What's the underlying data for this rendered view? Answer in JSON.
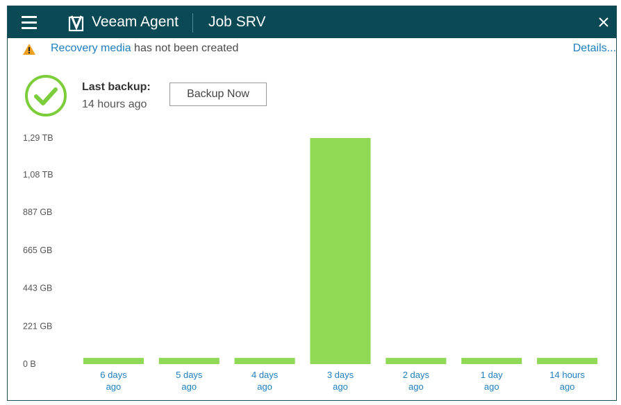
{
  "header": {
    "app_title": "Veeam Agent",
    "job_title": "Job SRV",
    "icons": {
      "menu": "hamburger-menu-icon",
      "logo": "veeam-logo-icon",
      "close": "close-icon"
    }
  },
  "warning": {
    "icon": "warning-triangle-icon",
    "link_text": "Recovery media",
    "text": " has not been created",
    "details_link": "Details..."
  },
  "status": {
    "icon": "success-check-icon",
    "last_backup_label": "Last backup:",
    "last_backup_time": "14 hours ago",
    "backup_now_label": "Backup Now"
  },
  "colors": {
    "titlebar": "#0b4a55",
    "accent_green": "#8fd957",
    "check_green": "#7ccd3c",
    "link_blue": "#1e7fc0",
    "warning_orange": "#f0a020"
  },
  "chart_data": {
    "type": "bar",
    "categories": [
      [
        "6 days",
        "ago"
      ],
      [
        "5 days",
        "ago"
      ],
      [
        "4 days",
        "ago"
      ],
      [
        "3 days",
        "ago"
      ],
      [
        "2 days",
        "ago"
      ],
      [
        "1 day",
        "ago"
      ],
      [
        "14 hours",
        "ago"
      ]
    ],
    "values_gb": [
      36,
      36,
      36,
      1321,
      36,
      36,
      36
    ],
    "yticks": [
      "0 B",
      "221 GB",
      "443 GB",
      "665 GB",
      "887 GB",
      "1,08 TB",
      "1,29 TB"
    ],
    "ytick_values_gb": [
      0,
      221,
      443,
      665,
      887,
      1106,
      1321
    ],
    "ylim": [
      0,
      1321
    ],
    "grid": false,
    "bar_color": "#8fd957"
  }
}
